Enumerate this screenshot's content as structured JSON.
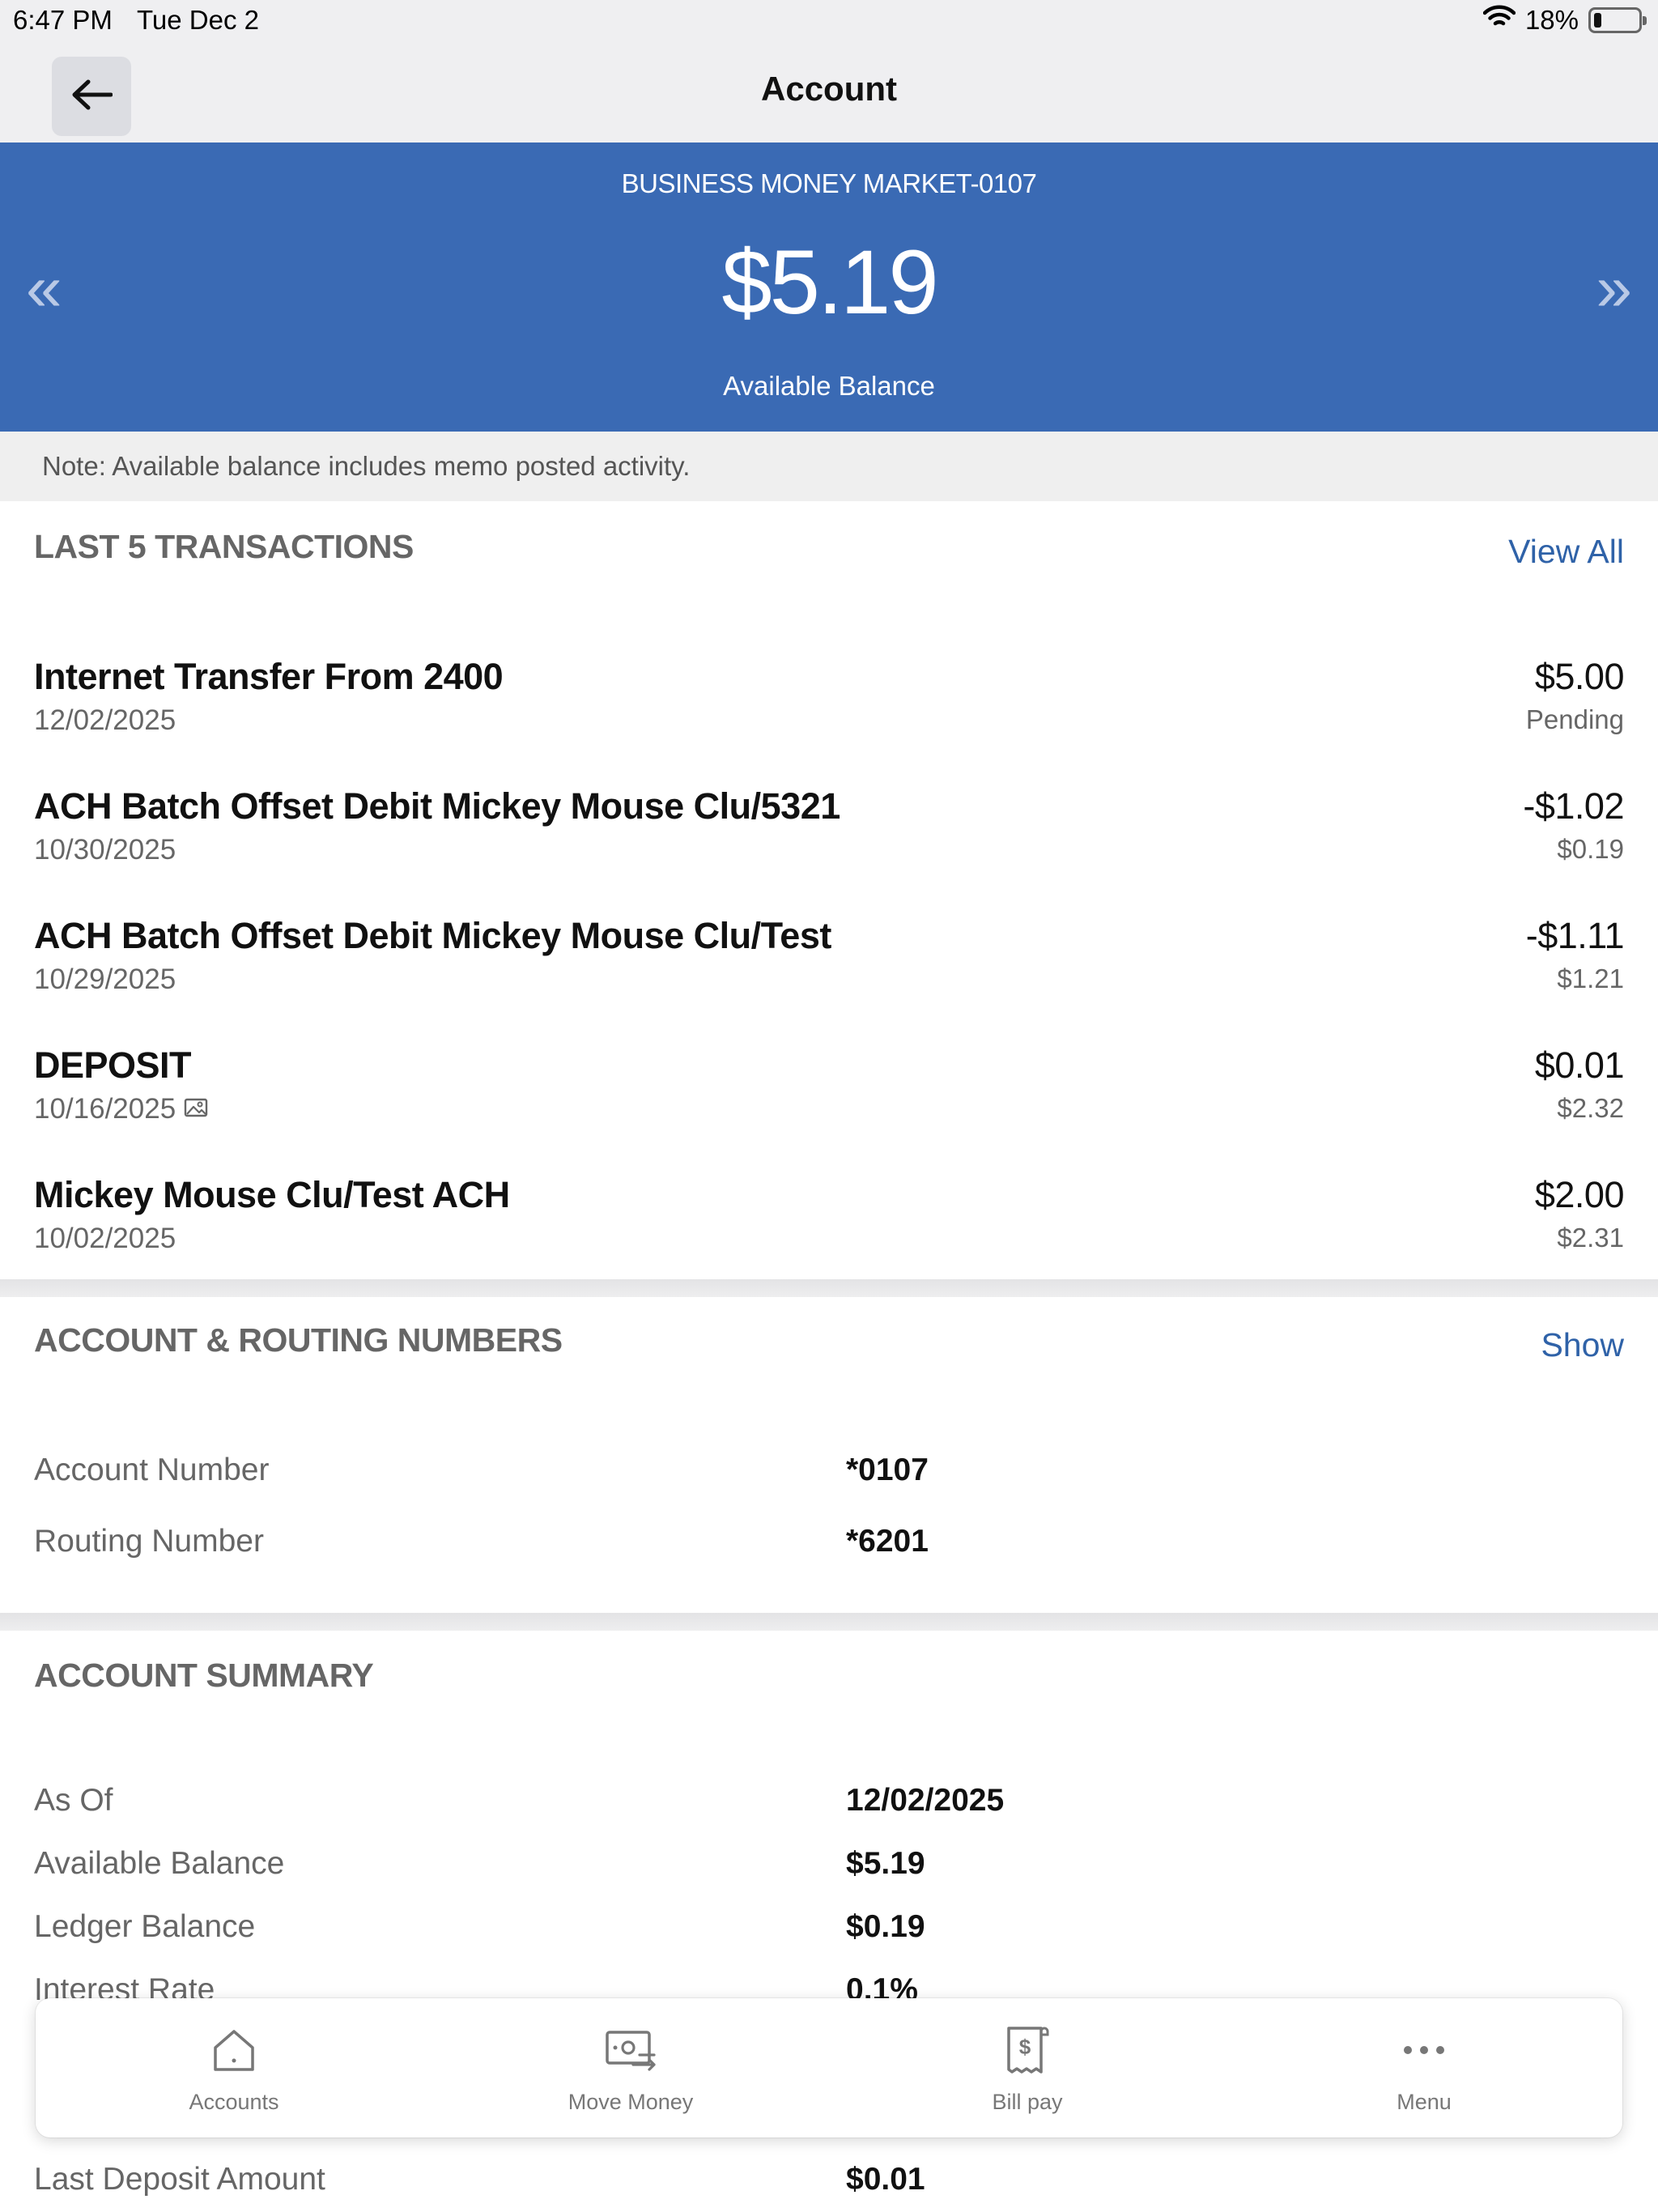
{
  "status_bar": {
    "time": "6:47 PM",
    "date": "Tue Dec 2",
    "battery": "18%",
    "battery_level": 0.18
  },
  "nav": {
    "title": "Account"
  },
  "hero": {
    "account_name": "BUSINESS MONEY MARKET-0107",
    "balance": "$5.19",
    "balance_label": "Available Balance",
    "prev_glyph": "«",
    "next_glyph": "»"
  },
  "note": "Note: Available balance includes memo posted activity.",
  "transactions": {
    "title": "LAST 5 TRANSACTIONS",
    "view_all": "View All",
    "items": [
      {
        "name": "Internet Transfer From 2400",
        "date": "12/02/2025",
        "amount": "$5.00",
        "sub": "Pending"
      },
      {
        "name": "ACH Batch Offset Debit Mickey Mouse Clu/5321",
        "date": "10/30/2025",
        "amount": "-$1.02",
        "sub": "$0.19"
      },
      {
        "name": "ACH Batch Offset Debit Mickey Mouse Clu/Test",
        "date": "10/29/2025",
        "amount": "-$1.11",
        "sub": "$1.21"
      },
      {
        "name": "DEPOSIT",
        "date": "10/16/2025",
        "amount": "$0.01",
        "sub": "$2.32",
        "has_image": true
      },
      {
        "name": "Mickey Mouse Clu/Test ACH",
        "date": "10/02/2025",
        "amount": "$2.00",
        "sub": "$2.31"
      }
    ]
  },
  "routing": {
    "title": "ACCOUNT & ROUTING NUMBERS",
    "show": "Show",
    "rows": [
      {
        "label": "Account Number",
        "value": "*0107"
      },
      {
        "label": "Routing Number",
        "value": "*6201"
      }
    ]
  },
  "summary": {
    "title": "ACCOUNT SUMMARY",
    "rows": [
      {
        "label": "As Of",
        "value": "12/02/2025"
      },
      {
        "label": "Available Balance",
        "value": "$5.19"
      },
      {
        "label": "Ledger Balance",
        "value": "$0.19"
      },
      {
        "label": "Interest Rate",
        "value": "0.1%"
      },
      {
        "label": "Last Deposit Amount",
        "value": "$0.01"
      }
    ]
  },
  "tabs": [
    {
      "label": "Accounts",
      "icon": "house-icon"
    },
    {
      "label": "Move Money",
      "icon": "money-transfer-icon"
    },
    {
      "label": "Bill pay",
      "icon": "bill-receipt-icon"
    },
    {
      "label": "Menu",
      "icon": "more-dots-icon"
    }
  ],
  "colors": {
    "hero_bg": "#3a6ab4",
    "link": "#2f62a8",
    "page_bg": "#ffffff"
  }
}
